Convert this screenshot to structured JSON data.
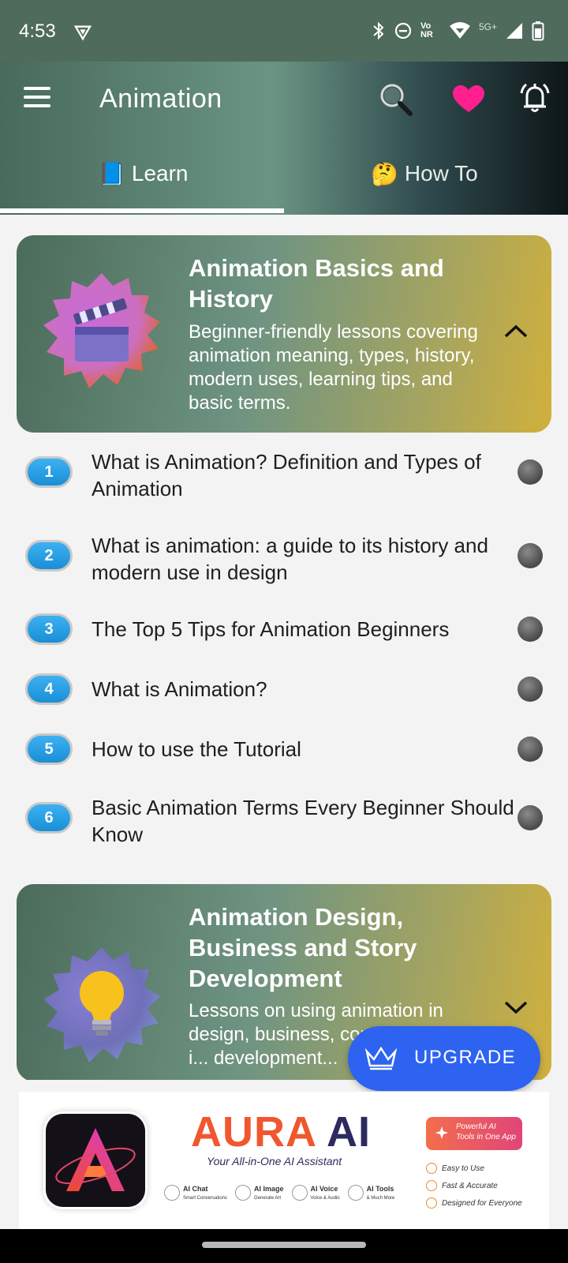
{
  "status_bar": {
    "time": "4:53",
    "network_label": "Vo NR",
    "network_type": "5G+"
  },
  "app_bar": {
    "title": "Animation",
    "tabs": [
      {
        "emoji": "📘",
        "label": "Learn",
        "selected": true
      },
      {
        "emoji": "🤔",
        "label": "How To",
        "selected": false
      }
    ]
  },
  "sections": [
    {
      "title": "Animation Basics and History",
      "description": "Beginner-friendly lessons covering animation meaning, types, history, modern uses, learning tips, and basic terms.",
      "icon": "clapperboard-icon",
      "expanded": true
    },
    {
      "title": "Animation Design, Business and Story Development",
      "description": "Lessons on using animation in design, business, communication, i... development...",
      "icon": "lightbulb-icon",
      "expanded": false
    }
  ],
  "lessons": [
    {
      "number": "1",
      "title": "What is Animation? Definition and Types of Animation"
    },
    {
      "number": "2",
      "title": "What is animation: a guide to its history and modern use in design"
    },
    {
      "number": "3",
      "title": "The Top 5 Tips for Animation Beginners"
    },
    {
      "number": "4",
      "title": "What is Animation?"
    },
    {
      "number": "5",
      "title": "How to use the Tutorial"
    },
    {
      "number": "6",
      "title": "Basic Animation Terms Every Beginner Should Know"
    }
  ],
  "upgrade": {
    "label": "UPGRADE"
  },
  "ad": {
    "brand_a": "AURA",
    "brand_b": "AI",
    "tagline": "Your All-in-One AI Assistant",
    "features": [
      {
        "name": "AI Chat",
        "sub": "Smart Conversations"
      },
      {
        "name": "AI Image",
        "sub": "Generate Art"
      },
      {
        "name": "AI Voice",
        "sub": "Voice & Audio"
      },
      {
        "name": "AI Tools",
        "sub": "& Much More"
      }
    ],
    "pill_line1": "Powerful AI",
    "pill_line2": "Tools in One App",
    "checks": [
      "Easy to Use",
      "Fast & Accurate",
      "Designed for Everyone"
    ]
  },
  "colors": {
    "accent_blue": "#2d63f0",
    "heart": "#ff1f8e",
    "number_badge": "#1a8fd6"
  }
}
